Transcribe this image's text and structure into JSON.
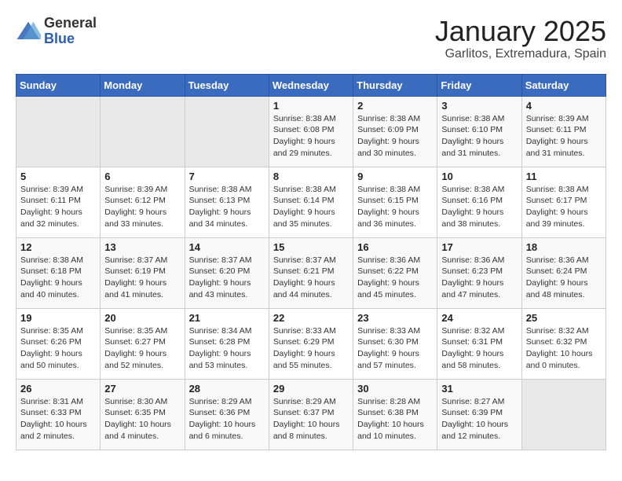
{
  "logo": {
    "general": "General",
    "blue": "Blue"
  },
  "title": "January 2025",
  "location": "Garlitos, Extremadura, Spain",
  "days_of_week": [
    "Sunday",
    "Monday",
    "Tuesday",
    "Wednesday",
    "Thursday",
    "Friday",
    "Saturday"
  ],
  "weeks": [
    [
      {
        "num": "",
        "info": ""
      },
      {
        "num": "",
        "info": ""
      },
      {
        "num": "",
        "info": ""
      },
      {
        "num": "1",
        "info": "Sunrise: 8:38 AM\nSunset: 6:08 PM\nDaylight: 9 hours\nand 29 minutes."
      },
      {
        "num": "2",
        "info": "Sunrise: 8:38 AM\nSunset: 6:09 PM\nDaylight: 9 hours\nand 30 minutes."
      },
      {
        "num": "3",
        "info": "Sunrise: 8:38 AM\nSunset: 6:10 PM\nDaylight: 9 hours\nand 31 minutes."
      },
      {
        "num": "4",
        "info": "Sunrise: 8:39 AM\nSunset: 6:11 PM\nDaylight: 9 hours\nand 31 minutes."
      }
    ],
    [
      {
        "num": "5",
        "info": "Sunrise: 8:39 AM\nSunset: 6:11 PM\nDaylight: 9 hours\nand 32 minutes."
      },
      {
        "num": "6",
        "info": "Sunrise: 8:39 AM\nSunset: 6:12 PM\nDaylight: 9 hours\nand 33 minutes."
      },
      {
        "num": "7",
        "info": "Sunrise: 8:38 AM\nSunset: 6:13 PM\nDaylight: 9 hours\nand 34 minutes."
      },
      {
        "num": "8",
        "info": "Sunrise: 8:38 AM\nSunset: 6:14 PM\nDaylight: 9 hours\nand 35 minutes."
      },
      {
        "num": "9",
        "info": "Sunrise: 8:38 AM\nSunset: 6:15 PM\nDaylight: 9 hours\nand 36 minutes."
      },
      {
        "num": "10",
        "info": "Sunrise: 8:38 AM\nSunset: 6:16 PM\nDaylight: 9 hours\nand 38 minutes."
      },
      {
        "num": "11",
        "info": "Sunrise: 8:38 AM\nSunset: 6:17 PM\nDaylight: 9 hours\nand 39 minutes."
      }
    ],
    [
      {
        "num": "12",
        "info": "Sunrise: 8:38 AM\nSunset: 6:18 PM\nDaylight: 9 hours\nand 40 minutes."
      },
      {
        "num": "13",
        "info": "Sunrise: 8:37 AM\nSunset: 6:19 PM\nDaylight: 9 hours\nand 41 minutes."
      },
      {
        "num": "14",
        "info": "Sunrise: 8:37 AM\nSunset: 6:20 PM\nDaylight: 9 hours\nand 43 minutes."
      },
      {
        "num": "15",
        "info": "Sunrise: 8:37 AM\nSunset: 6:21 PM\nDaylight: 9 hours\nand 44 minutes."
      },
      {
        "num": "16",
        "info": "Sunrise: 8:36 AM\nSunset: 6:22 PM\nDaylight: 9 hours\nand 45 minutes."
      },
      {
        "num": "17",
        "info": "Sunrise: 8:36 AM\nSunset: 6:23 PM\nDaylight: 9 hours\nand 47 minutes."
      },
      {
        "num": "18",
        "info": "Sunrise: 8:36 AM\nSunset: 6:24 PM\nDaylight: 9 hours\nand 48 minutes."
      }
    ],
    [
      {
        "num": "19",
        "info": "Sunrise: 8:35 AM\nSunset: 6:26 PM\nDaylight: 9 hours\nand 50 minutes."
      },
      {
        "num": "20",
        "info": "Sunrise: 8:35 AM\nSunset: 6:27 PM\nDaylight: 9 hours\nand 52 minutes."
      },
      {
        "num": "21",
        "info": "Sunrise: 8:34 AM\nSunset: 6:28 PM\nDaylight: 9 hours\nand 53 minutes."
      },
      {
        "num": "22",
        "info": "Sunrise: 8:33 AM\nSunset: 6:29 PM\nDaylight: 9 hours\nand 55 minutes."
      },
      {
        "num": "23",
        "info": "Sunrise: 8:33 AM\nSunset: 6:30 PM\nDaylight: 9 hours\nand 57 minutes."
      },
      {
        "num": "24",
        "info": "Sunrise: 8:32 AM\nSunset: 6:31 PM\nDaylight: 9 hours\nand 58 minutes."
      },
      {
        "num": "25",
        "info": "Sunrise: 8:32 AM\nSunset: 6:32 PM\nDaylight: 10 hours\nand 0 minutes."
      }
    ],
    [
      {
        "num": "26",
        "info": "Sunrise: 8:31 AM\nSunset: 6:33 PM\nDaylight: 10 hours\nand 2 minutes."
      },
      {
        "num": "27",
        "info": "Sunrise: 8:30 AM\nSunset: 6:35 PM\nDaylight: 10 hours\nand 4 minutes."
      },
      {
        "num": "28",
        "info": "Sunrise: 8:29 AM\nSunset: 6:36 PM\nDaylight: 10 hours\nand 6 minutes."
      },
      {
        "num": "29",
        "info": "Sunrise: 8:29 AM\nSunset: 6:37 PM\nDaylight: 10 hours\nand 8 minutes."
      },
      {
        "num": "30",
        "info": "Sunrise: 8:28 AM\nSunset: 6:38 PM\nDaylight: 10 hours\nand 10 minutes."
      },
      {
        "num": "31",
        "info": "Sunrise: 8:27 AM\nSunset: 6:39 PM\nDaylight: 10 hours\nand 12 minutes."
      },
      {
        "num": "",
        "info": ""
      }
    ]
  ],
  "empty_col_indices": {
    "week0": [
      0,
      1,
      2
    ],
    "week4": [
      6
    ]
  }
}
